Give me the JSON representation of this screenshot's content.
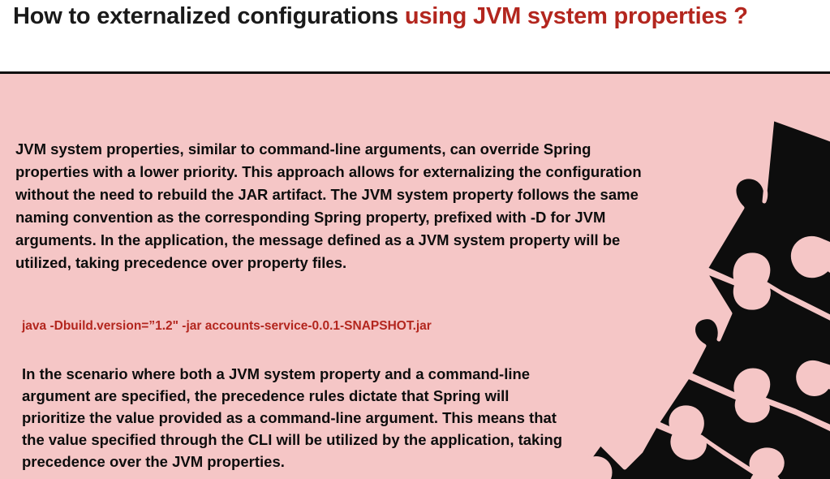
{
  "title": {
    "prefix": "How to externalized configurations ",
    "accent": "using JVM system properties ?"
  },
  "body": {
    "paragraph1": "JVM system properties, similar to command-line arguments, can override Spring properties with a lower priority. This approach allows for externalizing the configuration without the need to rebuild the JAR artifact. The JVM system property follows the same naming convention as the corresponding Spring property, prefixed with -D for JVM arguments. In the application, the message defined as a JVM system property will be utilized, taking precedence over property files.",
    "command": "java -Dbuild.version=”1.2\" -jar accounts-service-0.0.1-SNAPSHOT.jar",
    "paragraph2": "In the scenario where both a JVM system property and a command-line argument are specified, the precedence rules dictate that Spring will prioritize the value provided as a command-line argument. This means that the value specified through the CLI will be utilized by the application, taking precedence over the JVM properties."
  },
  "colors": {
    "accent": "#b3261e",
    "background": "#f5c6c6",
    "puzzle": "#0d0d0d"
  },
  "decoration": {
    "icon": "puzzle-pieces-icon"
  }
}
